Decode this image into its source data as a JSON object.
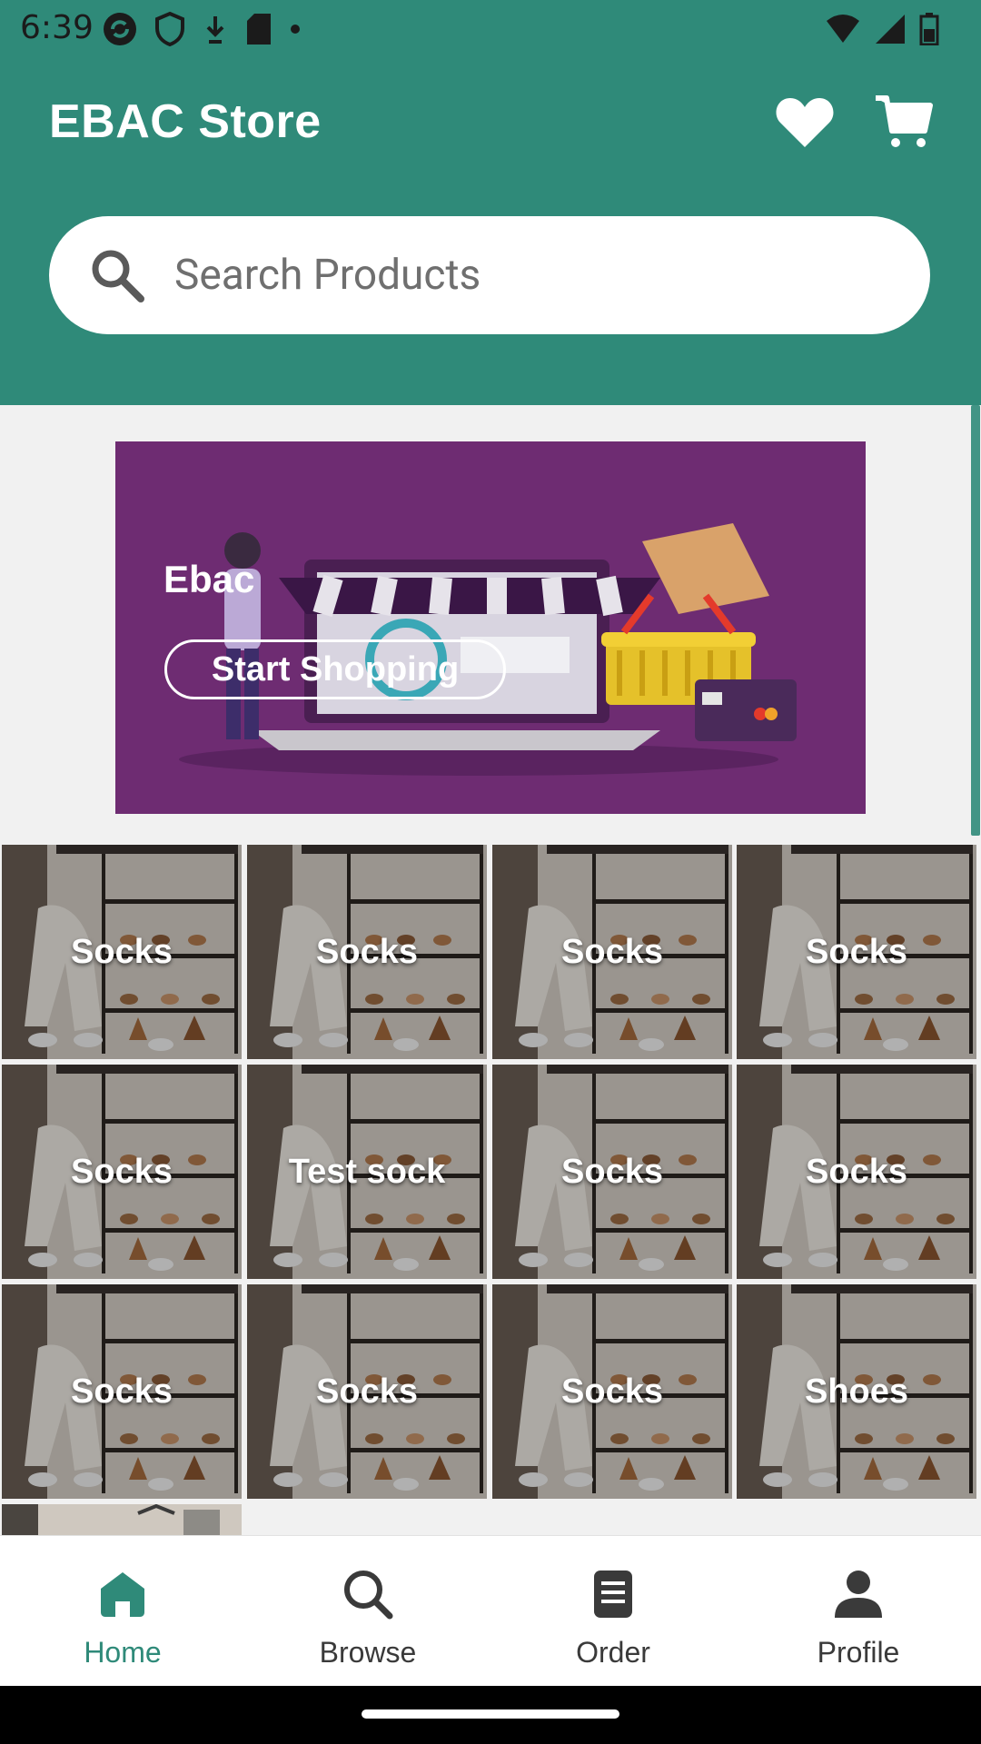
{
  "status_bar": {
    "time": "6:39"
  },
  "header": {
    "title": "EBAC Store"
  },
  "search": {
    "placeholder": "Search Products"
  },
  "banner": {
    "title": "Ebac",
    "button_label": "Start Shopping"
  },
  "products": [
    {
      "label": "Socks"
    },
    {
      "label": "Socks"
    },
    {
      "label": "Socks"
    },
    {
      "label": "Socks"
    },
    {
      "label": "Socks"
    },
    {
      "label": "Test sock"
    },
    {
      "label": "Socks"
    },
    {
      "label": "Socks"
    },
    {
      "label": "Socks"
    },
    {
      "label": "Socks"
    },
    {
      "label": "Socks"
    },
    {
      "label": "Shoes"
    }
  ],
  "bottom_nav": {
    "items": [
      {
        "label": "Home",
        "icon": "home-icon",
        "active": true
      },
      {
        "label": "Browse",
        "icon": "search-icon",
        "active": false
      },
      {
        "label": "Order",
        "icon": "order-icon",
        "active": false
      },
      {
        "label": "Profile",
        "icon": "person-icon",
        "active": false
      }
    ]
  },
  "colors": {
    "primary": "#2f8a79",
    "banner": "#6e2c72"
  }
}
